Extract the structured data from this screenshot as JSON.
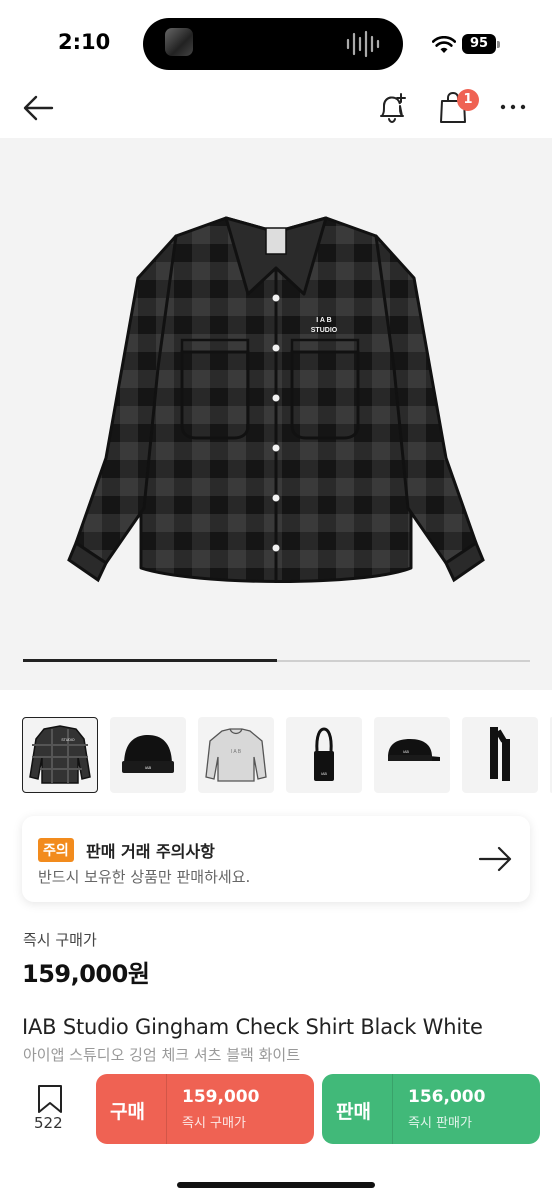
{
  "status": {
    "time": "2:10",
    "battery": "95"
  },
  "header": {
    "cart_badge": "1"
  },
  "product": {
    "images_total": 2,
    "images_current": 1,
    "thumbnails": [
      "shirt",
      "beanie",
      "sweatshirt",
      "tote-bag",
      "cap",
      "scarf"
    ]
  },
  "notice": {
    "badge": "주의",
    "title": "판매 거래 주의사항",
    "subtitle": "반드시 보유한 상품만 판매하세요."
  },
  "price": {
    "label": "즉시 구매가",
    "value": "159,000원"
  },
  "title": {
    "en": "IAB Studio Gingham Check Shirt Black White",
    "ko": "아이앱 스튜디오 깅엄 체크 셔츠 블랙 화이트"
  },
  "bottom": {
    "bookmark_count": "522",
    "buy": {
      "label": "구매",
      "price": "159,000",
      "sub": "즉시 구매가"
    },
    "sell": {
      "label": "판매",
      "price": "156,000",
      "sub": "즉시 판매가"
    }
  },
  "colors": {
    "buy": "#ef6253",
    "sell": "#41b979",
    "notice_badge": "#f28b1d"
  }
}
